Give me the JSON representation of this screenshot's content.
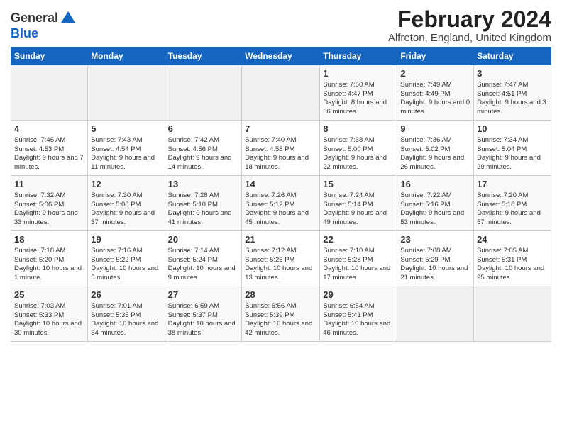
{
  "header": {
    "logo_line1": "General",
    "logo_line2": "Blue",
    "main_title": "February 2024",
    "subtitle": "Alfreton, England, United Kingdom"
  },
  "days_of_week": [
    "Sunday",
    "Monday",
    "Tuesday",
    "Wednesday",
    "Thursday",
    "Friday",
    "Saturday"
  ],
  "weeks": [
    [
      {
        "day": "",
        "info": ""
      },
      {
        "day": "",
        "info": ""
      },
      {
        "day": "",
        "info": ""
      },
      {
        "day": "",
        "info": ""
      },
      {
        "day": "1",
        "info": "Sunrise: 7:50 AM\nSunset: 4:47 PM\nDaylight: 8 hours and 56 minutes."
      },
      {
        "day": "2",
        "info": "Sunrise: 7:49 AM\nSunset: 4:49 PM\nDaylight: 9 hours and 0 minutes."
      },
      {
        "day": "3",
        "info": "Sunrise: 7:47 AM\nSunset: 4:51 PM\nDaylight: 9 hours and 3 minutes."
      }
    ],
    [
      {
        "day": "4",
        "info": "Sunrise: 7:45 AM\nSunset: 4:53 PM\nDaylight: 9 hours and 7 minutes."
      },
      {
        "day": "5",
        "info": "Sunrise: 7:43 AM\nSunset: 4:54 PM\nDaylight: 9 hours and 11 minutes."
      },
      {
        "day": "6",
        "info": "Sunrise: 7:42 AM\nSunset: 4:56 PM\nDaylight: 9 hours and 14 minutes."
      },
      {
        "day": "7",
        "info": "Sunrise: 7:40 AM\nSunset: 4:58 PM\nDaylight: 9 hours and 18 minutes."
      },
      {
        "day": "8",
        "info": "Sunrise: 7:38 AM\nSunset: 5:00 PM\nDaylight: 9 hours and 22 minutes."
      },
      {
        "day": "9",
        "info": "Sunrise: 7:36 AM\nSunset: 5:02 PM\nDaylight: 9 hours and 26 minutes."
      },
      {
        "day": "10",
        "info": "Sunrise: 7:34 AM\nSunset: 5:04 PM\nDaylight: 9 hours and 29 minutes."
      }
    ],
    [
      {
        "day": "11",
        "info": "Sunrise: 7:32 AM\nSunset: 5:06 PM\nDaylight: 9 hours and 33 minutes."
      },
      {
        "day": "12",
        "info": "Sunrise: 7:30 AM\nSunset: 5:08 PM\nDaylight: 9 hours and 37 minutes."
      },
      {
        "day": "13",
        "info": "Sunrise: 7:28 AM\nSunset: 5:10 PM\nDaylight: 9 hours and 41 minutes."
      },
      {
        "day": "14",
        "info": "Sunrise: 7:26 AM\nSunset: 5:12 PM\nDaylight: 9 hours and 45 minutes."
      },
      {
        "day": "15",
        "info": "Sunrise: 7:24 AM\nSunset: 5:14 PM\nDaylight: 9 hours and 49 minutes."
      },
      {
        "day": "16",
        "info": "Sunrise: 7:22 AM\nSunset: 5:16 PM\nDaylight: 9 hours and 53 minutes."
      },
      {
        "day": "17",
        "info": "Sunrise: 7:20 AM\nSunset: 5:18 PM\nDaylight: 9 hours and 57 minutes."
      }
    ],
    [
      {
        "day": "18",
        "info": "Sunrise: 7:18 AM\nSunset: 5:20 PM\nDaylight: 10 hours and 1 minute."
      },
      {
        "day": "19",
        "info": "Sunrise: 7:16 AM\nSunset: 5:22 PM\nDaylight: 10 hours and 5 minutes."
      },
      {
        "day": "20",
        "info": "Sunrise: 7:14 AM\nSunset: 5:24 PM\nDaylight: 10 hours and 9 minutes."
      },
      {
        "day": "21",
        "info": "Sunrise: 7:12 AM\nSunset: 5:26 PM\nDaylight: 10 hours and 13 minutes."
      },
      {
        "day": "22",
        "info": "Sunrise: 7:10 AM\nSunset: 5:28 PM\nDaylight: 10 hours and 17 minutes."
      },
      {
        "day": "23",
        "info": "Sunrise: 7:08 AM\nSunset: 5:29 PM\nDaylight: 10 hours and 21 minutes."
      },
      {
        "day": "24",
        "info": "Sunrise: 7:05 AM\nSunset: 5:31 PM\nDaylight: 10 hours and 25 minutes."
      }
    ],
    [
      {
        "day": "25",
        "info": "Sunrise: 7:03 AM\nSunset: 5:33 PM\nDaylight: 10 hours and 30 minutes."
      },
      {
        "day": "26",
        "info": "Sunrise: 7:01 AM\nSunset: 5:35 PM\nDaylight: 10 hours and 34 minutes."
      },
      {
        "day": "27",
        "info": "Sunrise: 6:59 AM\nSunset: 5:37 PM\nDaylight: 10 hours and 38 minutes."
      },
      {
        "day": "28",
        "info": "Sunrise: 6:56 AM\nSunset: 5:39 PM\nDaylight: 10 hours and 42 minutes."
      },
      {
        "day": "29",
        "info": "Sunrise: 6:54 AM\nSunset: 5:41 PM\nDaylight: 10 hours and 46 minutes."
      },
      {
        "day": "",
        "info": ""
      },
      {
        "day": "",
        "info": ""
      }
    ]
  ]
}
